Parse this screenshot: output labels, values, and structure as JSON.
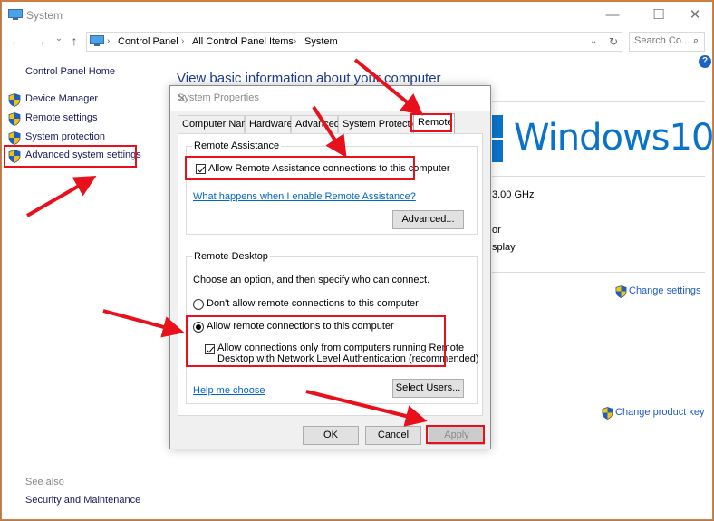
{
  "window": {
    "title": "System",
    "controls": {
      "minimize": "—",
      "maximize": "☐",
      "close": "✕"
    }
  },
  "address_bar": {
    "crumbs": [
      "Control Panel",
      "All Control Panel Items",
      "System"
    ],
    "separator": "›",
    "refresh": "↻",
    "dropdown": "⌄",
    "search_placeholder": "Search Co...",
    "search_icon": "⌕"
  },
  "nav": {
    "back": "←",
    "forward": "→",
    "recent": "⌄",
    "up": "↑"
  },
  "help_icon": "?",
  "sidebar": {
    "home": "Control Panel Home",
    "items": [
      {
        "label": "Device Manager",
        "icon": "uac-shield-icon"
      },
      {
        "label": "Remote settings",
        "icon": "uac-shield-icon"
      },
      {
        "label": "System protection",
        "icon": "uac-shield-icon"
      },
      {
        "label": "Advanced system settings",
        "icon": "uac-shield-icon",
        "highlighted": true
      }
    ],
    "see_also_label": "See also",
    "see_also_links": [
      "Security and Maintenance"
    ]
  },
  "main": {
    "heading": "View basic information about your computer",
    "brand": "Windows10",
    "fragments": [
      "3.00 GHz",
      "or",
      "splay"
    ],
    "change_settings": "Change settings",
    "change_product_key": "Change product key"
  },
  "dialog": {
    "title": "System Properties",
    "close": "✕",
    "tabs": [
      "Computer Name",
      "Hardware",
      "Advanced",
      "System Protection",
      "Remote"
    ],
    "active_tab": "Remote",
    "remote_assistance": {
      "legend": "Remote Assistance",
      "allow_label": "Allow Remote Assistance connections to this computer",
      "allow_checked": true,
      "help_link": "What happens when I enable Remote Assistance?",
      "advanced_button": "Advanced..."
    },
    "remote_desktop": {
      "legend": "Remote Desktop",
      "instructions": "Choose an option, and then specify who can connect.",
      "option_deny": "Don't allow remote connections to this computer",
      "option_allow": "Allow remote connections to this computer",
      "selected": "allow",
      "nla_label_line1": "Allow connections only from computers running Remote",
      "nla_label_line2": "Desktop with Network Level Authentication (recommended)",
      "nla_checked": true,
      "help_link": "Help me choose",
      "select_users_button": "Select Users..."
    },
    "buttons": {
      "ok": "OK",
      "cancel": "Cancel",
      "apply": "Apply"
    }
  },
  "annotations": {
    "color": "#e8101a"
  }
}
